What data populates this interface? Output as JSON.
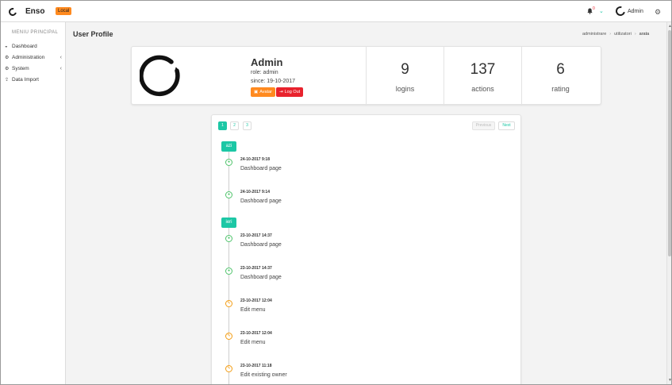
{
  "topbar": {
    "app_name": "Enso",
    "env_badge": "Local",
    "notifications_count": "0",
    "user_name": "Admin"
  },
  "sidebar": {
    "title": "MENIU PRINCIPAL",
    "items": [
      {
        "label": "Dashboard",
        "icon": "dashboard-icon",
        "has_children": false
      },
      {
        "label": "Administration",
        "icon": "cogs-icon",
        "has_children": true
      },
      {
        "label": "System",
        "icon": "gear-icon",
        "has_children": true
      },
      {
        "label": "Data Import",
        "icon": "upload-icon",
        "has_children": false
      }
    ]
  },
  "header": {
    "title": "User Profile",
    "breadcrumb": [
      "administrare",
      "utilizatori",
      "arata"
    ]
  },
  "profile": {
    "name": "Admin",
    "role": "role: admin",
    "since": "since: 19-10-2017",
    "avatar_button": "Avatar",
    "logout_button": "Log Out",
    "stats": [
      {
        "value": "9",
        "label": "logins"
      },
      {
        "value": "137",
        "label": "actions"
      },
      {
        "value": "6",
        "label": "rating"
      }
    ]
  },
  "timeline": {
    "pages": [
      "1",
      "2",
      "3"
    ],
    "active_page": "1",
    "previous_label": "Previous",
    "next_label": "Next",
    "days": [
      {
        "tag": "azi",
        "events": [
          {
            "time": "24-10-2017 9:18",
            "text": "Dashboard page",
            "type": "view"
          },
          {
            "time": "24-10-2017 9:14",
            "text": "Dashboard page",
            "type": "view"
          }
        ]
      },
      {
        "tag": "ieri",
        "events": [
          {
            "time": "23-10-2017 14:37",
            "text": "Dashboard page",
            "type": "view"
          },
          {
            "time": "23-10-2017 14:37",
            "text": "Dashboard page",
            "type": "view"
          },
          {
            "time": "23-10-2017 12:04",
            "text": "Edit menu",
            "type": "edit"
          },
          {
            "time": "23-10-2017 12:04",
            "text": "Edit menu",
            "type": "edit"
          },
          {
            "time": "23-10-2017 11:18",
            "text": "Edit existing owner",
            "type": "edit"
          }
        ]
      }
    ]
  },
  "colors": {
    "accent": "#1cc7a5",
    "warning": "#ff8a1f",
    "danger": "#e8222d",
    "view_event": "#4fc36b",
    "edit_event": "#f39c12"
  }
}
